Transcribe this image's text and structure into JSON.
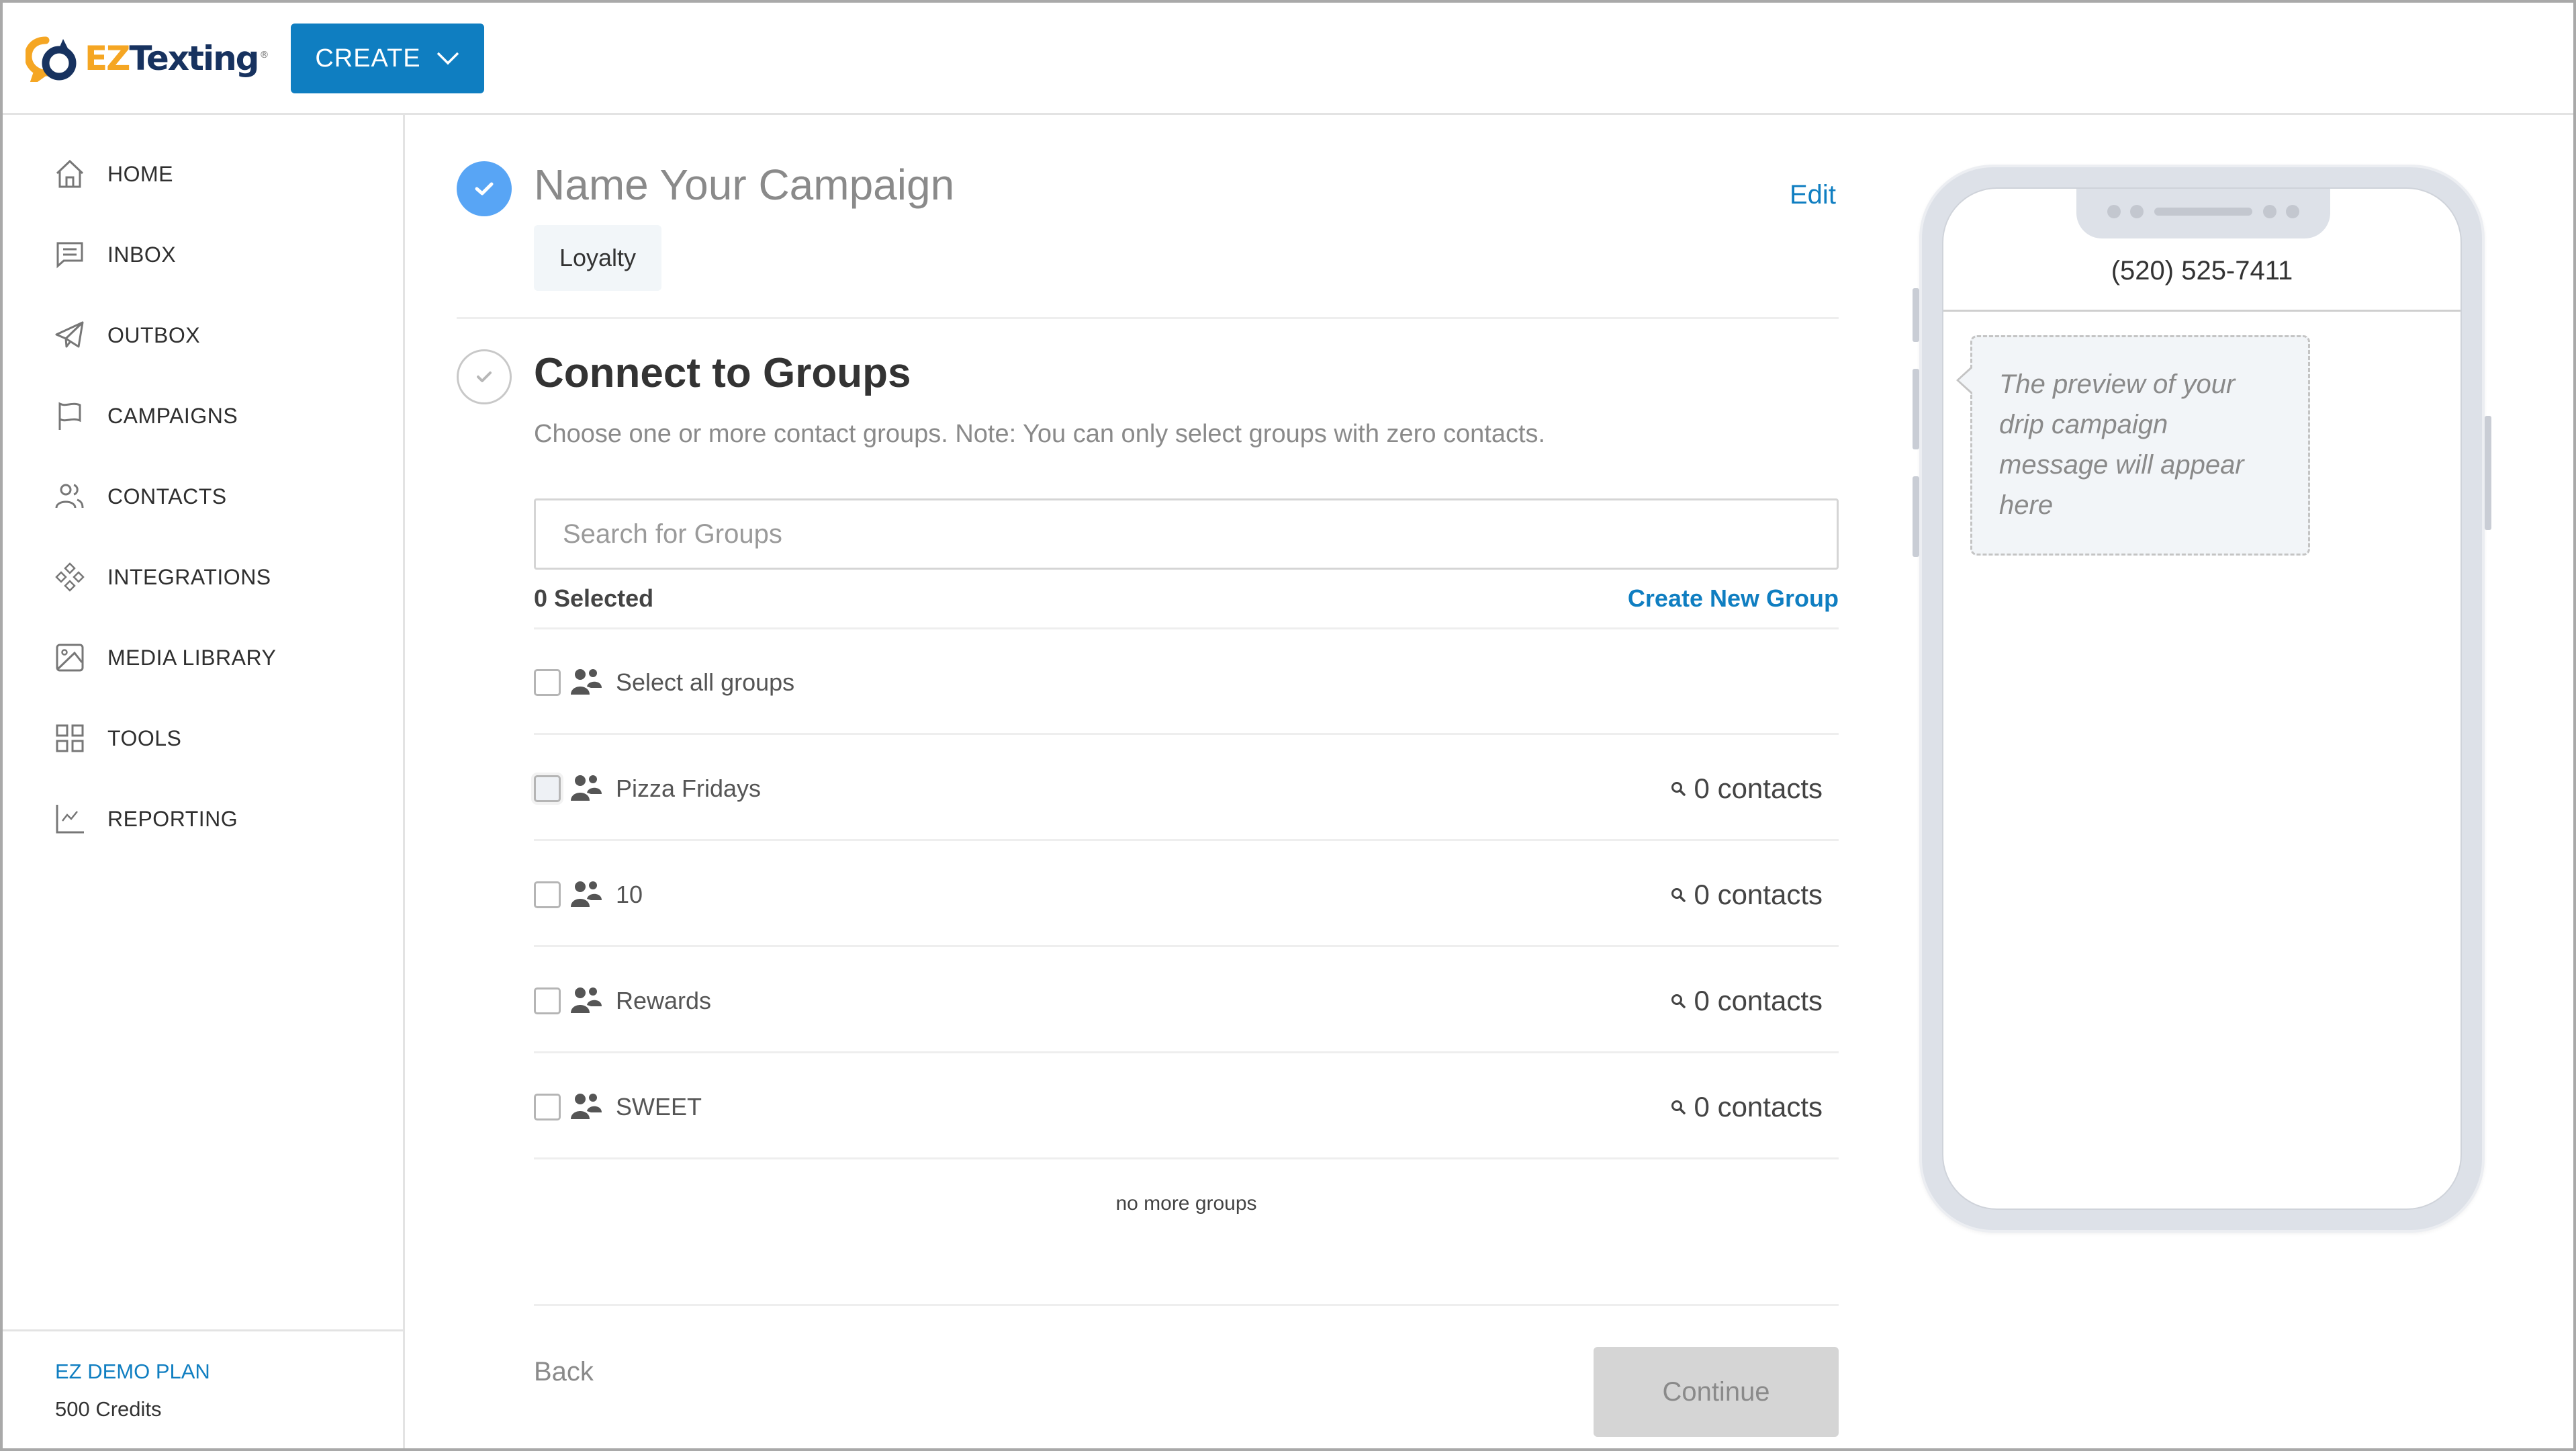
{
  "header": {
    "logo": {
      "ez": "EZ",
      "texting": "Texting",
      "reg": "®"
    },
    "create_label": "CREATE"
  },
  "sidebar": {
    "items": [
      {
        "label": "HOME",
        "icon": "home-icon"
      },
      {
        "label": "INBOX",
        "icon": "message-icon"
      },
      {
        "label": "OUTBOX",
        "icon": "paper-plane-icon"
      },
      {
        "label": "CAMPAIGNS",
        "icon": "flag-icon"
      },
      {
        "label": "CONTACTS",
        "icon": "users-icon"
      },
      {
        "label": "INTEGRATIONS",
        "icon": "integrations-icon"
      },
      {
        "label": "MEDIA LIBRARY",
        "icon": "image-icon"
      },
      {
        "label": "TOOLS",
        "icon": "grid-icon"
      },
      {
        "label": "REPORTING",
        "icon": "chart-line-icon"
      }
    ],
    "plan": "EZ DEMO PLAN",
    "credits": "500 Credits"
  },
  "steps": {
    "name_campaign": {
      "title": "Name Your Campaign",
      "edit_label": "Edit",
      "value": "Loyalty",
      "status": "complete"
    },
    "connect_groups": {
      "title": "Connect to Groups",
      "description": "Choose one or more contact groups. Note: You can only select groups with zero contacts.",
      "search_placeholder": "Search for Groups",
      "search_value": "",
      "selected_count": "0 Selected",
      "create_group_label": "Create New Group",
      "select_all_label": "Select all groups",
      "groups": [
        {
          "name": "Pizza Fridays",
          "contacts": "0 contacts",
          "checked": false
        },
        {
          "name": "10",
          "contacts": "0 contacts",
          "checked": false
        },
        {
          "name": "Rewards",
          "contacts": "0 contacts",
          "checked": false
        },
        {
          "name": "SWEET",
          "contacts": "0 contacts",
          "checked": false
        }
      ],
      "no_more_label": "no more groups"
    }
  },
  "footer_actions": {
    "back_label": "Back",
    "continue_label": "Continue"
  },
  "preview": {
    "phone_number": "(520) 525-7411",
    "placeholder_message": "The preview of your drip campaign message will appear here"
  },
  "colors": {
    "brand_blue": "#0f7ec1",
    "step_complete": "#58a5f5",
    "logo_orange": "#f5a623",
    "logo_navy": "#17325f"
  }
}
